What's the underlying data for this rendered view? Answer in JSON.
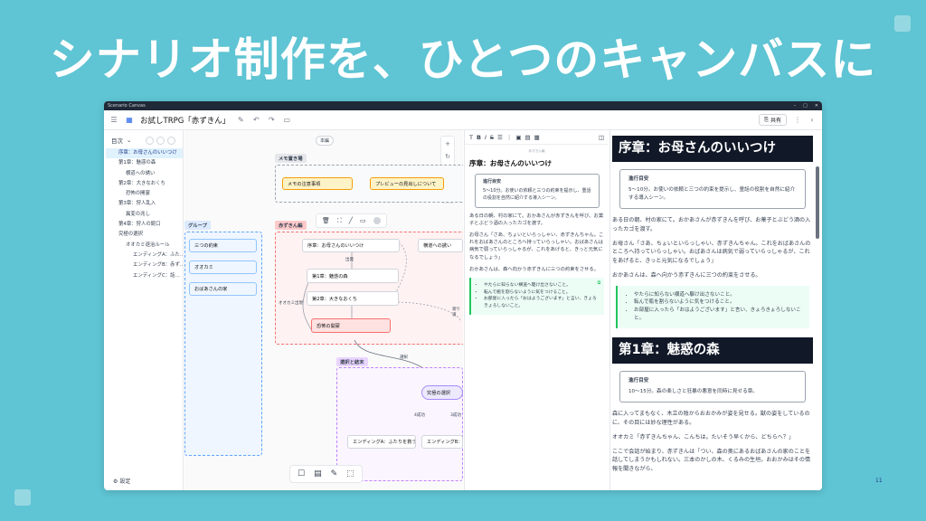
{
  "headline": "シナリオ制作を、ひとつのキャンバスに",
  "page_number": "11",
  "window": {
    "title": "Scenario Canvas",
    "doc_title": "お試しTRPG「赤ずきん」",
    "share_label": "共有"
  },
  "sidebar": {
    "heading": "目次",
    "items": [
      "序章：お母さんのいいつけ",
      "第1章：魅惑の森",
      "横道への誘い",
      "第2章：大きなおくち",
      "恐怖の開宴",
      "第3章：狩人乱入",
      "異変の兆し",
      "第4章：狩人の銃口",
      "究極の選択",
      "オオカミ退治ルール",
      "エンディングA：ふた…",
      "エンディングB：赤ず…",
      "エンディングC：話…"
    ],
    "footer": "設定"
  },
  "canvas": {
    "zoom_label": "本編",
    "group_memo": {
      "label": "メモ置き場",
      "notes": [
        "メモの注意事項",
        "プレビューの見出しについて"
      ]
    },
    "group_left": {
      "label": "グループ",
      "nodes": [
        "三つの約束",
        "オオカミ",
        "おばあさんの家"
      ]
    },
    "group_main": {
      "label": "赤ずきん編",
      "nodes": [
        "序章：お母さんのいいつけ",
        "第1章：魅惑の森",
        "第2章：大きなおくち",
        "恐怖の開宴",
        "横道への誘い"
      ],
      "edge_labels": [
        "出発",
        "オオカミ出現",
        "寄り道"
      ]
    },
    "group_choice": {
      "label": "選択と結末",
      "nodes": [
        "究極の選択",
        "エンディングA：ふたりを救う",
        "エンディングB：赤ず"
      ],
      "edge_labels": [
        "選択",
        "4成功",
        "3成功"
      ]
    }
  },
  "editor": {
    "crumb": "赤ずきん編",
    "heading": "序章：お母さんのいいつけ",
    "box_title": "進行目安",
    "box_text": "5〜10分。お使いの依頼と三つの約束を提示し、重話の役割を自然に紹介する導入シーン。",
    "paragraphs": [
      "ある日の朝、村の家にて。おかあさんが赤ずきんを呼び、お菓子とぶどう酒の入ったカゴを渡す。",
      "お母さん「さあ、ちょいといらっしゃい、赤ずきんちゃん。これをおばあさんのところへ持っていらっしゃい。おばあさんは病気で弱っていらっしゃるが、これをあげると、きっと元気になるでしょう」",
      "おかあさんは、森へ向かう赤ずきんに三つの約束をさせる。"
    ],
    "callout": [
      "やたらに知らない横道へ駆け出さないこと。",
      "転んで瓶を割らないように気をつけること。",
      "お部屋に入ったら「おはようございます」と言い、きょろきょろしないこと。"
    ]
  },
  "preview": {
    "heading1": "序章：お母さんのいいつけ",
    "box1_title": "進行目安",
    "box1_text": "5〜10分。お使いの依頼と三つの約束を提示し、童話の役割を自然に紹介する導入シーン。",
    "paragraphs1": [
      "ある日の朝、村の家にて。おかあさんが赤ずきんを呼び、お菓子とぶどう酒の入ったカゴを渡す。",
      "お母さん「さあ、ちょいといらっしゃい、赤ずきんちゃん。これをおばあさんのところへ持っていらっしゃい。おばあさんは病気で弱っていらっしゃるが、これをあげると、きっと元気になるでしょう」",
      "おかあさんは、森へ向かう赤ずきんに三つの約束をさせる。"
    ],
    "callout": [
      "やたらに知らない横道へ駆け出さないこと。",
      "転んで瓶を割らないように気をつけること。",
      "お部屋に入ったら「おはようございます」と言い、きょろきょろしないこと。"
    ],
    "heading2": "第1章：魅惑の森",
    "box2_title": "進行目安",
    "box2_text": "10〜15分。森の楽しさと狂暴の悪意を同時に見せる章。",
    "paragraphs2": [
      "森に入ってまもなく、木立の陰からおおかみが姿を見せる。獣の姿をしているのに、その目には妙な理性がある。",
      "オオカミ「赤ずきんちゃん、こんちは。たいそう早くから、どちらへ？」",
      "ここで会話が始まり、赤ずきんは「つい、森の奥にあるおばあさんの家のことを話してしまうかもしれない。三本のかしの木、くるみの生垣。おおかみはその情報を聞きながら、"
    ]
  }
}
